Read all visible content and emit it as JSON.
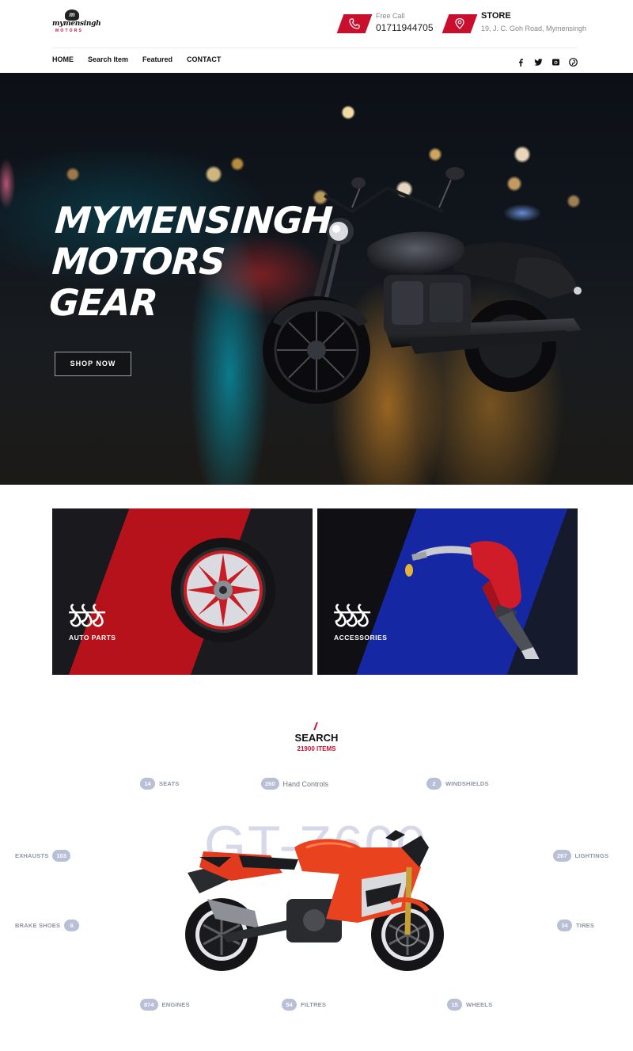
{
  "brand": {
    "name": "mymensingh",
    "sub": "MOTORS"
  },
  "contact": {
    "call": {
      "label": "Free Call",
      "value": "01711944705"
    },
    "store": {
      "label": "STORE",
      "value": "19, J. C. Goh Road, Mymensingh"
    }
  },
  "nav": [
    "HOME",
    "Search Item",
    "Featured",
    "CONTACT"
  ],
  "social": [
    "facebook-icon",
    "twitter-icon",
    "instagram-icon",
    "pinterest-icon"
  ],
  "hero": {
    "line1": "MYMENSINGH",
    "line2": "MOTORS",
    "line3": "GEAR",
    "button": "SHOP NOW"
  },
  "categories": [
    {
      "glyph": "ঠঠঠ",
      "label": "AUTO PARTS",
      "accent": "#b5121b"
    },
    {
      "glyph": "ঠঠঠ",
      "label": "ACCESSORIES",
      "accent": "#1527a2"
    }
  ],
  "search": {
    "title": "SEARCH",
    "count": "21900 ITEMS",
    "watermark": "GT-Z600",
    "tags": [
      {
        "count": "14",
        "label": "SEATS"
      },
      {
        "count": "260",
        "label": "Hand Controls"
      },
      {
        "count": "2",
        "label": "WINDSHIELDS"
      },
      {
        "count": "103",
        "label": "EXHAUSTS"
      },
      {
        "count": "267",
        "label": "LIGHTINGS"
      },
      {
        "count": "6",
        "label": "BRAKE SHOES"
      },
      {
        "count": "34",
        "label": "TIRES"
      },
      {
        "count": "874",
        "label": "ENGINES"
      },
      {
        "count": "54",
        "label": "FILTRES"
      },
      {
        "count": "15",
        "label": "WHEELS"
      }
    ]
  },
  "colors": {
    "accent": "#c8102e",
    "pill": "#b8bfd6"
  }
}
